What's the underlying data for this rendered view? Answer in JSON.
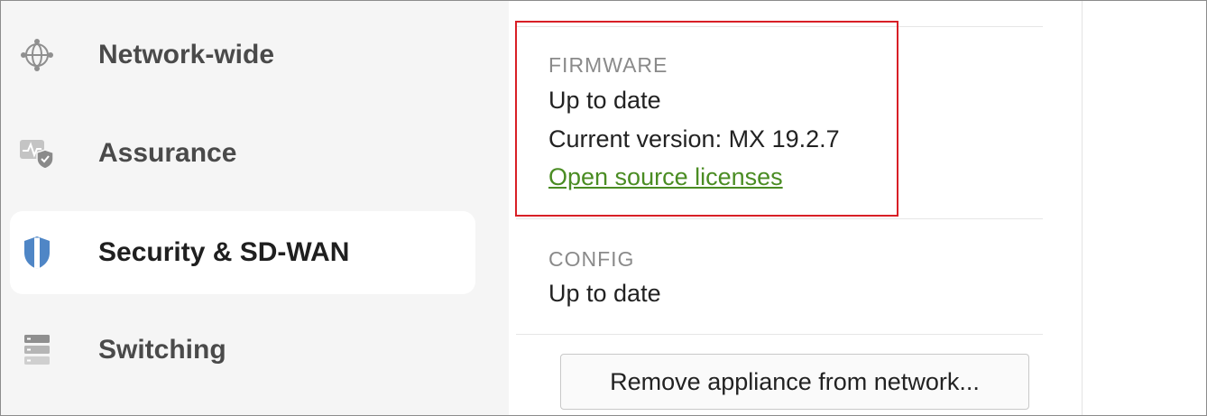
{
  "sidebar": {
    "items": [
      {
        "label": "Network-wide",
        "icon": "globe-network-icon"
      },
      {
        "label": "Assurance",
        "icon": "assurance-shield-icon"
      },
      {
        "label": "Security & SD-WAN",
        "icon": "shield-icon",
        "active": true
      },
      {
        "label": "Switching",
        "icon": "switch-stack-icon"
      }
    ]
  },
  "firmware": {
    "heading": "FIRMWARE",
    "status": "Up to date",
    "version": "Current version: MX 19.2.7",
    "link_label": "Open source licenses"
  },
  "config": {
    "heading": "CONFIG",
    "status": "Up to date"
  },
  "actions": {
    "remove_label": "Remove appliance from network..."
  },
  "colors": {
    "highlight": "#d81f26",
    "link": "#4a8c23",
    "shield": "#4f86c6"
  }
}
